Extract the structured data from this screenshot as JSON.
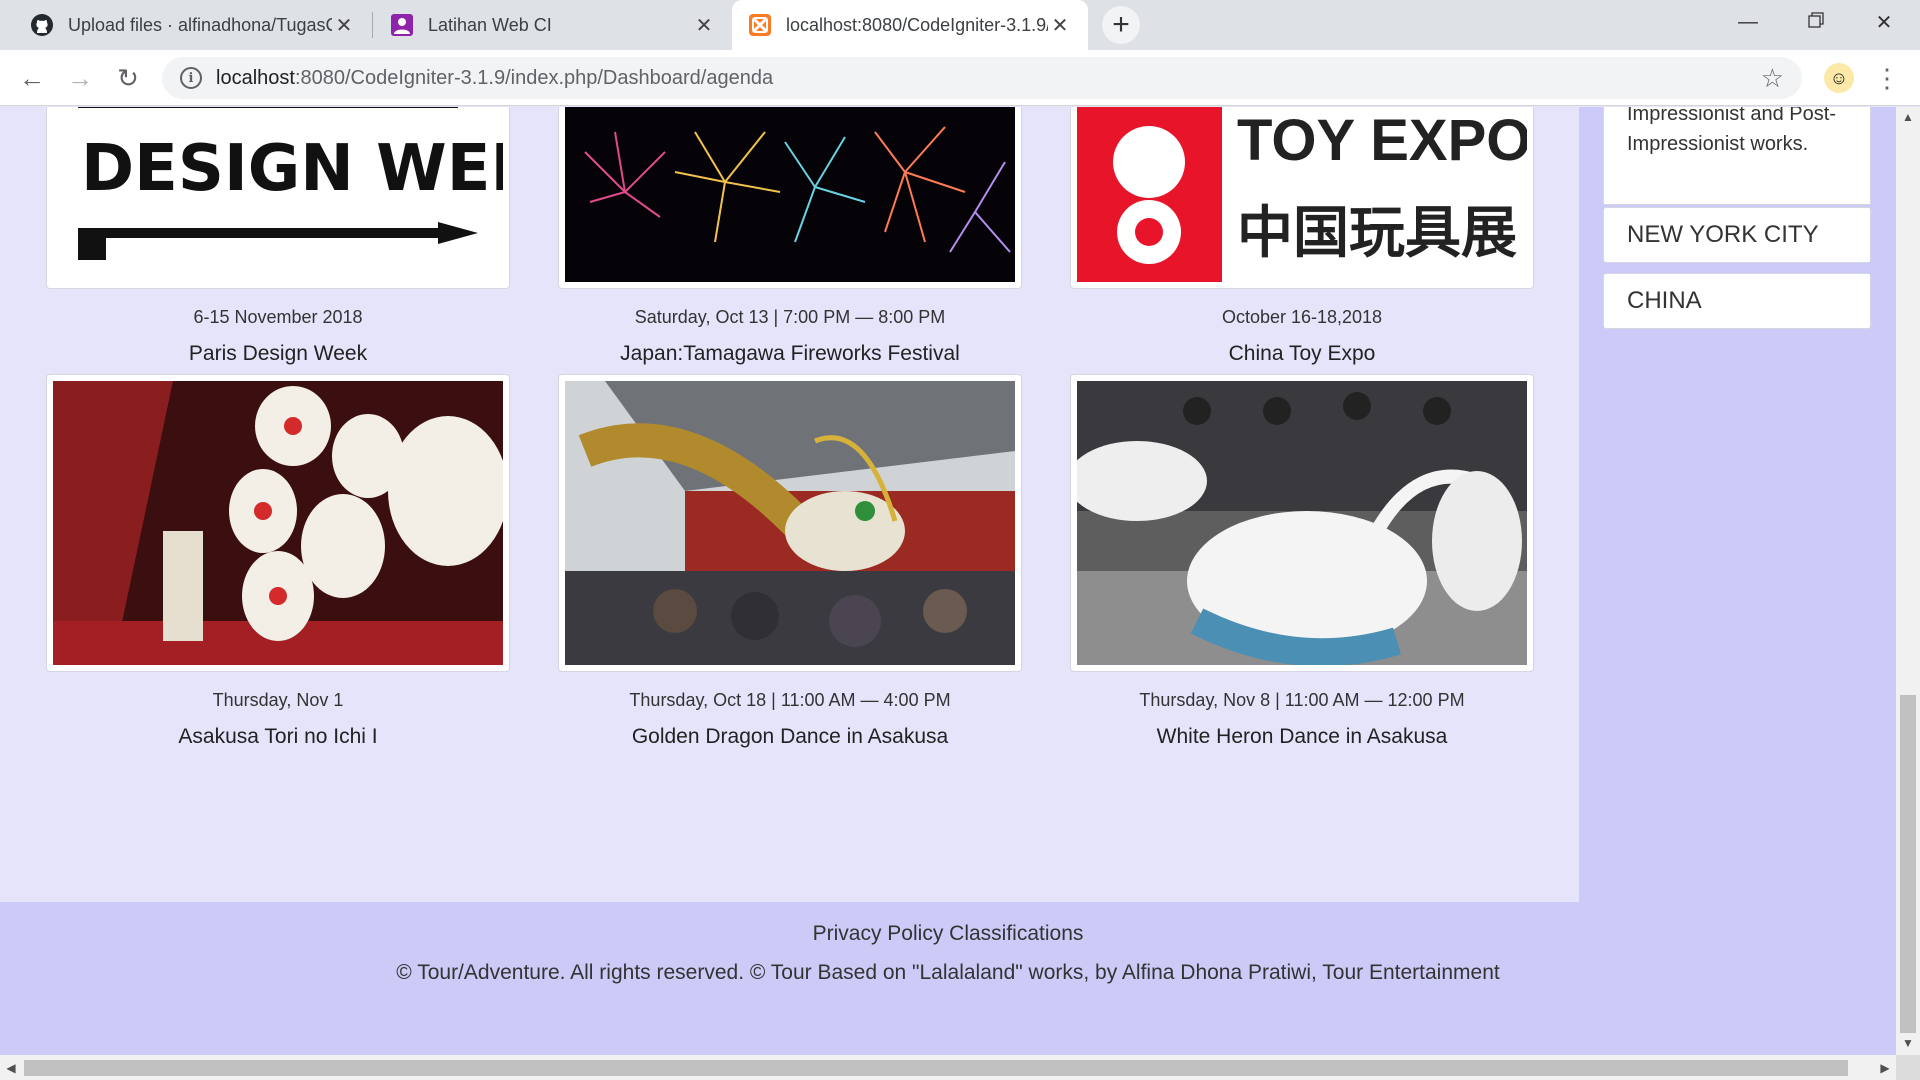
{
  "browser": {
    "tabs": [
      {
        "title": "Upload files · alfinadhona/TugasC",
        "icon": "github-icon"
      },
      {
        "title": "Latihan Web CI",
        "icon": "profile-icon"
      },
      {
        "title": "localhost:8080/CodeIgniter-3.1.9/",
        "icon": "xampp-icon"
      }
    ],
    "url_host": "localhost",
    "url_path": ":8080/CodeIgniter-3.1.9/index.php/Dashboard/agenda"
  },
  "events": [
    {
      "date": "6-15 November 2018",
      "name": "Paris Design Week",
      "image": "design-week-logo",
      "image_text": "DESIGN WEEK"
    },
    {
      "date": "Saturday, Oct 13 | 7:00 PM — 8:00 PM",
      "name": "Japan:Tamagawa Fireworks Festival",
      "image": "fireworks-photo"
    },
    {
      "date": "October 16-18,2018",
      "name": "China Toy Expo",
      "image": "toy-expo-logo",
      "image_text": "TOY EXPO",
      "image_text_cn": "中国玩具展"
    },
    {
      "date": "Thursday, Nov 1",
      "name": "Asakusa Tori no Ichi I",
      "image": "lanterns-photo"
    },
    {
      "date": "Thursday, Oct 18 | 11:00 AM — 4:00 PM",
      "name": "Golden Dragon Dance in Asakusa",
      "image": "dragon-dance-photo"
    },
    {
      "date": "Thursday, Nov 8 | 11:00 AM — 12:00 PM",
      "name": "White Heron Dance in Asakusa",
      "image": "heron-dance-photo"
    }
  ],
  "sidebar": {
    "text": "Impressionist and Post-Impressionist works.",
    "cities": [
      "NEW YORK CITY",
      "CHINA"
    ]
  },
  "footer": {
    "links": "Privacy Policy Classifications",
    "copyright": "© Tour/Adventure. All rights reserved. © Tour Based on \"Lalalaland\" works, by Alfina Dhona Pratiwi, Tour Entertainment"
  },
  "colors": {
    "page_bg": "#e5e4fb",
    "sidebar_bg": "#cccbf8",
    "footer_bg": "#cccbf8"
  }
}
